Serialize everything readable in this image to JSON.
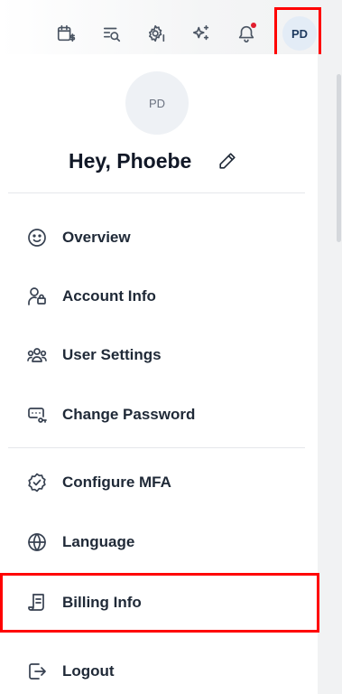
{
  "header": {
    "icons": [
      "calendar-dollar-icon",
      "search-list-icon",
      "gear-dollar-icon",
      "sparkles-icon",
      "bell-icon"
    ],
    "avatar_initials": "PD",
    "notification_dot_color": "#e11d2e"
  },
  "profile": {
    "avatar_initials": "PD",
    "greeting": "Hey, Phoebe"
  },
  "menu": {
    "overview": "Overview",
    "account_info": "Account Info",
    "user_settings": "User Settings",
    "change_password": "Change Password",
    "configure_mfa": "Configure MFA",
    "language": "Language",
    "billing_info": "Billing Info",
    "logout": "Logout"
  },
  "highlight_color": "#ff0000"
}
